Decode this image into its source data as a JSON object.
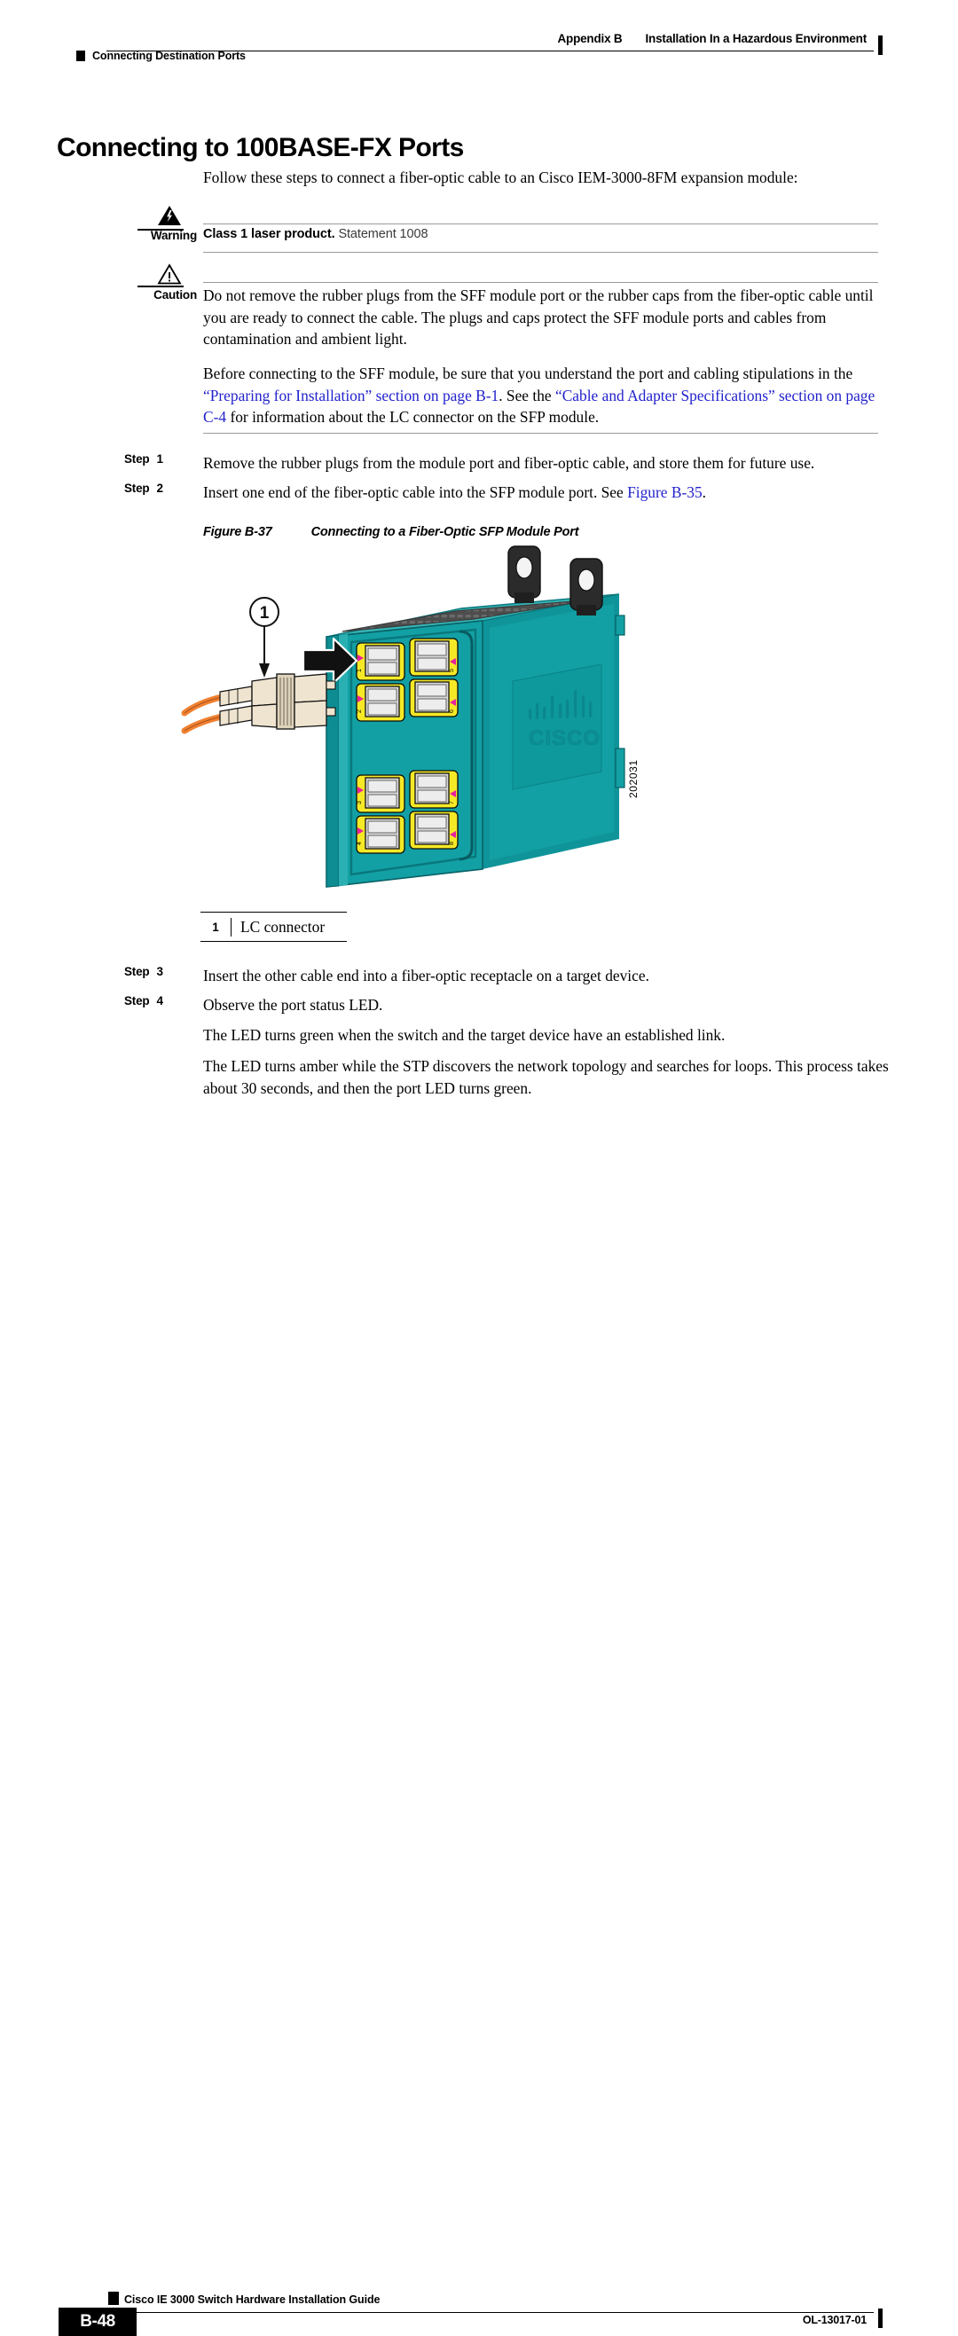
{
  "header": {
    "appendix": "Appendix B",
    "appendix_title": "Installation In a Hazardous Environment",
    "section_marker": "Connecting Destination Ports"
  },
  "main": {
    "title": "Connecting to 100BASE-FX Ports",
    "intro": "Follow these steps to connect a fiber-optic cable to an Cisco IEM-3000-8FM expansion module:"
  },
  "warning": {
    "label": "Warning",
    "icon": "warning-lightning-triangle-icon",
    "bold_text": "Class 1 laser product.",
    "statement": "Statement 1008"
  },
  "caution": {
    "label": "Caution",
    "icon": "caution-exclamation-triangle-icon",
    "text": "Do not remove the rubber plugs from the SFF module port or the rubber caps from the fiber-optic cable until you are ready to connect the cable. The plugs and caps protect the SFF module ports and cables from contamination and ambient light."
  },
  "sff_note": {
    "part1": "Before connecting to the SFF module, be sure that you understand the port and cabling stipulations in the ",
    "link1": "“Preparing for Installation” section on page B-1",
    "part2": ". See the ",
    "link2": "“Cable and Adapter Specifications” section on page C-4",
    "part3": " for information about the LC connector on the SFP module."
  },
  "steps": [
    {
      "label": "Step",
      "number": "1",
      "text": "Remove the rubber plugs from the module port and fiber-optic cable, and store them for future use."
    },
    {
      "label": "Step",
      "number": "2",
      "text_before": "Insert one end of the fiber-optic cable into the SFP module port. See ",
      "link": "Figure B-35",
      "text_after": "."
    },
    {
      "label": "Step",
      "number": "3",
      "text": "Insert the other cable end into a fiber-optic receptacle on a target device."
    },
    {
      "label": "Step",
      "number": "4",
      "text": "Observe the port status LED."
    }
  ],
  "closing": {
    "para1": "The LED turns green when the switch and the target device have an established link.",
    "para2": "The LED turns amber while the STP discovers the network topology and searches for loops. This process takes about 30 seconds, and then the port LED turns green."
  },
  "figure": {
    "number": "Figure B-37",
    "title": "Connecting to a Fiber-Optic SFP Module Port",
    "art_id": "202031",
    "callout_number": "1",
    "legend": [
      {
        "key": "1",
        "value": "LC connector"
      }
    ],
    "port_numbers": [
      "1",
      "2",
      "3",
      "4",
      "5",
      "6",
      "7",
      "8"
    ],
    "chassis_brand": "CISCO",
    "colors": {
      "chassis_teal": "#12a0a4",
      "chassis_teal_dark": "#0b7f86",
      "chassis_teal_light": "#35b5b6",
      "bezel_yellow": "#f5e927",
      "led_magenta": "#e81fa0",
      "cable_orange": "#f08030",
      "connector_cream": "#efe4cf",
      "vent_gray": "#4d4d4d",
      "tab_black": "#2b2b2b",
      "arrow_black": "#111111"
    }
  },
  "footer": {
    "guide_title": "Cisco IE 3000 Switch Hardware Installation Guide",
    "page_number": "B-48",
    "doc_number": "OL-13017-01"
  }
}
